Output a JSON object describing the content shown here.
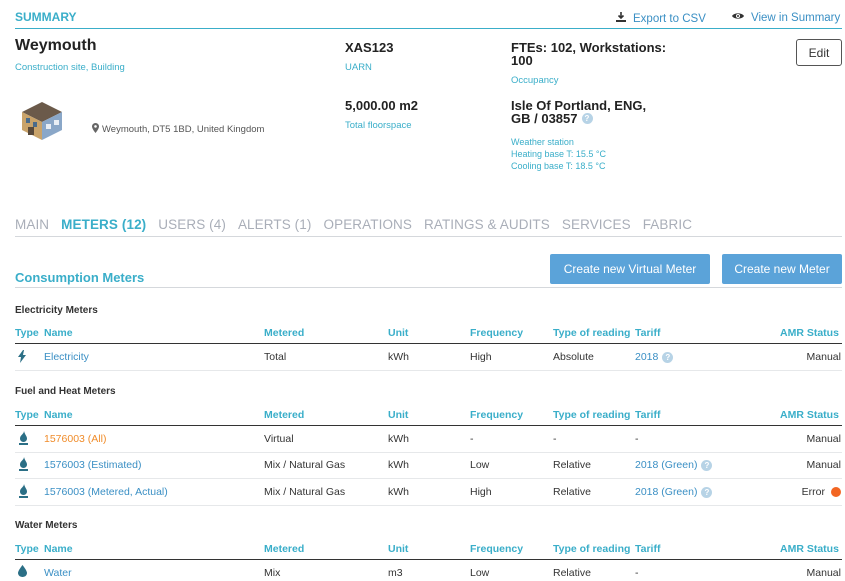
{
  "header": {
    "section_title": "SUMMARY",
    "export_label": "Export to CSV",
    "view_label": "View in Summary"
  },
  "building": {
    "name": "Weymouth",
    "type": "Construction site, Building",
    "address": "Weymouth, DT5 1BD, United Kingdom",
    "uarn_value": "XAS123",
    "uarn_label": "UARN",
    "floorspace_value": "5,000.00 m2",
    "floorspace_label": "Total floorspace",
    "occupancy_line1": "FTEs: 102, Workstations:",
    "occupancy_line2": "100",
    "occupancy_label": "Occupancy",
    "weather_line1": "Isle Of Portland, ENG,",
    "weather_line2": "GB / 03857",
    "weather_label": "Weather station",
    "heating_base": "Heating base T: 15.5 °C",
    "cooling_base": "Cooling base T: 18.5 °C",
    "edit_label": "Edit"
  },
  "tabs": [
    {
      "label": "MAIN"
    },
    {
      "label": "METERS (12)"
    },
    {
      "label": "USERS (4)"
    },
    {
      "label": "ALERTS (1)"
    },
    {
      "label": "OPERATIONS"
    },
    {
      "label": "RATINGS & AUDITS"
    },
    {
      "label": "SERVICES"
    },
    {
      "label": "FABRIC"
    }
  ],
  "meters": {
    "section_title": "Consumption Meters",
    "create_virtual_label": "Create new Virtual Meter",
    "create_meter_label": "Create new Meter",
    "columns": {
      "type": "Type",
      "name": "Name",
      "metered": "Metered",
      "unit": "Unit",
      "frequency": "Frequency",
      "reading": "Type of reading",
      "tariff": "Tariff",
      "amr": "AMR Status"
    },
    "electricity": {
      "title": "Electricity Meters",
      "rows": [
        {
          "name": "Electricity",
          "metered": "Total",
          "unit": "kWh",
          "frequency": "High",
          "reading": "Absolute",
          "tariff": "2018",
          "amr": "Manual"
        }
      ]
    },
    "fuel": {
      "title": "Fuel and Heat Meters",
      "rows": [
        {
          "name": "1576003 (All)",
          "metered": "Virtual",
          "unit": "kWh",
          "frequency": "-",
          "reading": "-",
          "tariff": "-",
          "amr": "Manual"
        },
        {
          "name": "1576003 (Estimated)",
          "metered": "Mix / Natural Gas",
          "unit": "kWh",
          "frequency": "Low",
          "reading": "Relative",
          "tariff": "2018 (Green)",
          "amr": "Manual"
        },
        {
          "name": "1576003 (Metered, Actual)",
          "metered": "Mix / Natural Gas",
          "unit": "kWh",
          "frequency": "High",
          "reading": "Relative",
          "tariff": "2018 (Green)",
          "amr": "Error"
        }
      ]
    },
    "water": {
      "title": "Water Meters",
      "rows": [
        {
          "name": "Water",
          "metered": "Mix",
          "unit": "m3",
          "frequency": "Low",
          "reading": "Relative",
          "tariff": "-",
          "amr": "Manual"
        }
      ]
    }
  },
  "colors": {
    "accent": "#3aaec9",
    "button_blue": "#5ba3d9",
    "virtual_orange": "#f08c2a",
    "error_orange": "#f26522"
  }
}
